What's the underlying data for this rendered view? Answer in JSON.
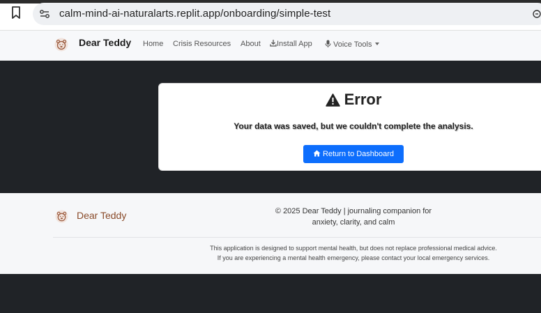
{
  "browser": {
    "url": "calm-mind-ai-naturalarts.replit.app/onboarding/simple-test"
  },
  "navbar": {
    "brand": "Dear Teddy",
    "links": [
      "Home",
      "Crisis Resources",
      "About"
    ],
    "install_app": "Install App",
    "voice_tools": "Voice Tools"
  },
  "error": {
    "title": "Error",
    "message": "Your data was saved, but we couldn't complete the analysis.",
    "button_label": "Return to Dashboard"
  },
  "footer": {
    "brand": "Dear Teddy",
    "copyright_line1": "© 2025 Dear Teddy | journaling companion for",
    "copyright_line2": "anxiety, clarity, and calm",
    "disclaimer_line1": "This application is designed to support mental health, but does not replace professional medical advice.",
    "disclaimer_line2": "If you are experiencing a mental health emergency, please contact your local emergency services."
  },
  "colors": {
    "primary": "#0d6efd",
    "brand_brown": "#8a4b2a",
    "dark_bg": "#202327"
  }
}
